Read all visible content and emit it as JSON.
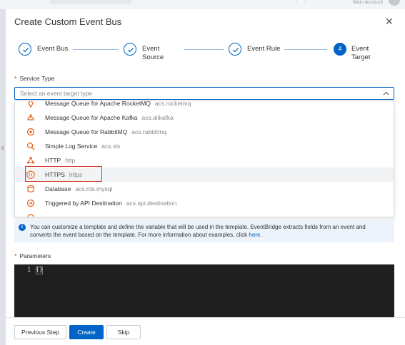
{
  "topbar": {
    "account": "Main Account"
  },
  "dialog": {
    "title": "Create Custom Event Bus"
  },
  "steps": [
    {
      "label": "Event Bus",
      "state": "done"
    },
    {
      "label": "Event Source",
      "state": "done"
    },
    {
      "label": "Event Rule",
      "state": "done"
    },
    {
      "number": "4",
      "label": "Event Target",
      "state": "active"
    }
  ],
  "service_type": {
    "label": "Service Type",
    "placeholder": "Select an event target type"
  },
  "dropdown": {
    "options": [
      {
        "name": "Message Queue for Apache RocketMQ",
        "code": "acs.rocketmq",
        "icon": "rocketmq-icon"
      },
      {
        "name": "Message Queue for Apache Kafka",
        "code": "acs.alikafka",
        "icon": "kafka-icon"
      },
      {
        "name": "Message Queue for RabbitMQ",
        "code": "acs.rabbitmq",
        "icon": "rabbitmq-icon"
      },
      {
        "name": "Simple Log Service",
        "code": "acs.sls",
        "icon": "sls-icon"
      },
      {
        "name": "HTTP",
        "code": "http",
        "icon": "http-icon"
      },
      {
        "name": "HTTPS",
        "code": "https",
        "icon": "https-icon",
        "highlighted": true
      },
      {
        "name": "Database",
        "code": "acs.rds.mysql",
        "icon": "database-icon"
      },
      {
        "name": "Triggered by API Destination",
        "code": "acs.api.destination",
        "icon": "api-destination-icon"
      }
    ]
  },
  "info": {
    "text": "You can customize a template and define the variable that will be used in the template. EventBridge extracts fields from an event and converts the event based on the template. For more information about examples, click",
    "link": "here",
    "end": "."
  },
  "parameters": {
    "label": "Parameters",
    "line_number": "1",
    "code": "{}"
  },
  "footer": {
    "previous": "Previous Step",
    "create": "Create",
    "skip": "Skip"
  },
  "colors": {
    "primary": "#0064c8",
    "required": "#d93026",
    "icon_orange": "#e8590c"
  }
}
